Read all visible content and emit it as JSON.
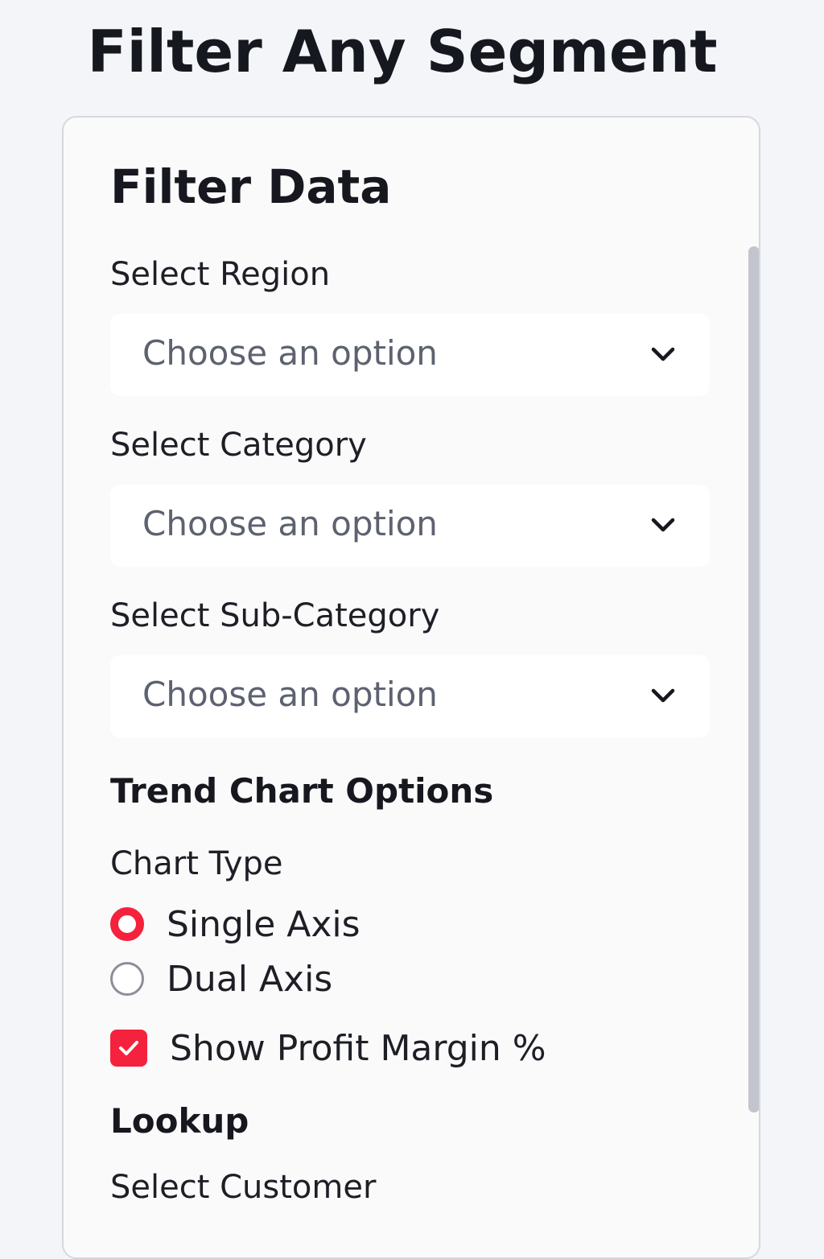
{
  "page": {
    "title": "Filter Any Segment"
  },
  "panel": {
    "heading": "Filter Data",
    "region": {
      "label": "Select Region",
      "placeholder": "Choose an option"
    },
    "category": {
      "label": "Select Category",
      "placeholder": "Choose an option"
    },
    "subcategory": {
      "label": "Select Sub-Category",
      "placeholder": "Choose an option"
    },
    "trend_options": {
      "heading": "Trend Chart Options",
      "chart_type_label": "Chart Type",
      "options": [
        {
          "label": "Single Axis",
          "selected": true
        },
        {
          "label": "Dual Axis",
          "selected": false
        }
      ],
      "show_profit_margin": {
        "label": "Show Profit Margin %",
        "checked": true
      }
    },
    "lookup": {
      "heading": "Lookup",
      "customer_label": "Select Customer"
    }
  },
  "icons": {
    "dropdown": "chevron-down-icon",
    "checkbox": "check-icon"
  },
  "colors": {
    "accent": "#f4223c",
    "background": "#f4f5f8",
    "panel": "#fafafb",
    "placeholder": "#5d6270"
  }
}
